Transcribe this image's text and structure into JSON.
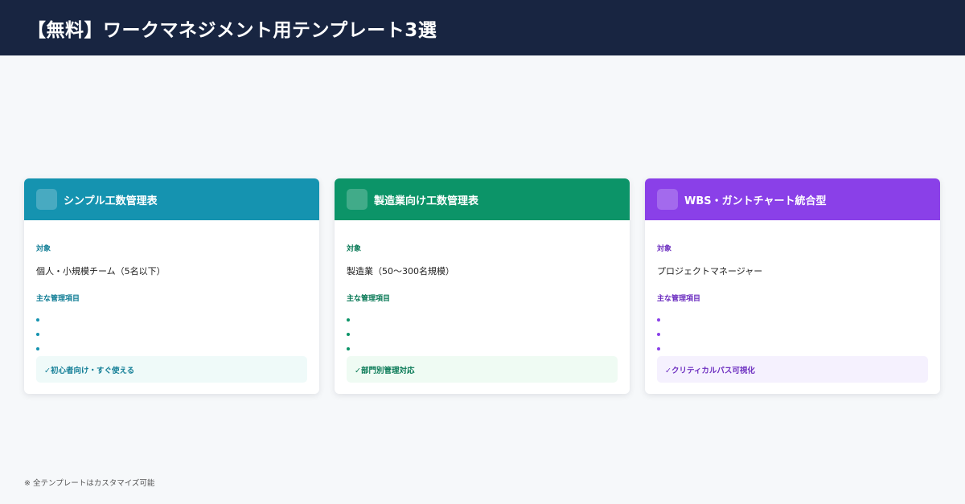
{
  "header": {
    "title": "【無料】ワークマネジメント用テンプレート3選"
  },
  "cards": [
    {
      "title": "シンプル工数管理表",
      "target_label": "対象",
      "target": "個人・小規模チーム（5名以下）",
      "items_label": "主な管理項目",
      "feature": "✓初心者向け・すぐ使える",
      "accent": "#1593b0",
      "text_accent": "#127e96",
      "feature_bg": "#effaf9"
    },
    {
      "title": "製造業向け工数管理表",
      "target_label": "対象",
      "target": "製造業（50〜300名規模）",
      "items_label": "主な管理項目",
      "feature": "✓部門別管理対応",
      "accent": "#0c9468",
      "text_accent": "#0a7a57",
      "feature_bg": "#effbf3"
    },
    {
      "title": "WBS・ガントチャート統合型",
      "target_label": "対象",
      "target": "プロジェクトマネージャー",
      "items_label": "主な管理項目",
      "feature": "✓クリティカルパス可視化",
      "accent": "#8a40e8",
      "text_accent": "#6d2fc0",
      "feature_bg": "#f5f1fe"
    }
  ],
  "footer": {
    "note": "※ 全テンプレートはカスタマイズ可能"
  }
}
